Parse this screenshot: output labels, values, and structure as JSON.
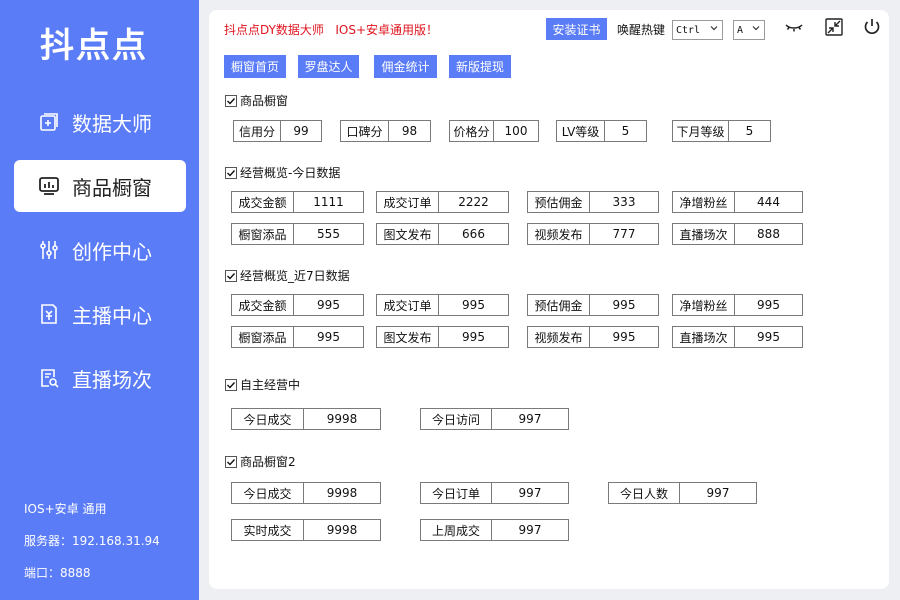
{
  "sidebar": {
    "logo": "抖点点",
    "items": [
      {
        "label": "数据大师",
        "icon": "data-add-icon"
      },
      {
        "label": "商品橱窗",
        "icon": "display-icon"
      },
      {
        "label": "创作中心",
        "icon": "sliders-icon"
      },
      {
        "label": "主播中心",
        "icon": "anchor-doc-icon"
      },
      {
        "label": "直播场次",
        "icon": "search-doc-icon"
      }
    ],
    "active_index": 1,
    "info": {
      "platform": "IOS+安卓 通用",
      "server": "服务器：192.168.31.94",
      "port": "端口：8888"
    }
  },
  "header": {
    "title": "抖点点DY数据大师   IOS+安卓通用版！",
    "cert_button": "安装证书",
    "hotkey_label": "唤醒热键",
    "hotkey_mod": "Ctrl",
    "hotkey_key": "A"
  },
  "tabs": [
    "橱窗首页",
    "罗盘达人",
    "佣金统计",
    "新版提现"
  ],
  "sections": {
    "s1": {
      "label": "商品橱窗",
      "fields": [
        {
          "label": "信用分",
          "value": "99"
        },
        {
          "label": "口碑分",
          "value": "98"
        },
        {
          "label": "价格分",
          "value": "100"
        },
        {
          "label": "LV等级",
          "value": "5"
        },
        {
          "label": "下月等级",
          "value": "5"
        }
      ]
    },
    "s2": {
      "label": "经营概览-今日数据",
      "fields": [
        {
          "label": "成交金额",
          "value": "1111"
        },
        {
          "label": "成交订单",
          "value": "2222"
        },
        {
          "label": "预估佣金",
          "value": "333"
        },
        {
          "label": "净增粉丝",
          "value": "444"
        },
        {
          "label": "橱窗添品",
          "value": "555"
        },
        {
          "label": "图文发布",
          "value": "666"
        },
        {
          "label": "视频发布",
          "value": "777"
        },
        {
          "label": "直播场次",
          "value": "888"
        }
      ]
    },
    "s3": {
      "label": "经营概览_近7日数据",
      "fields": [
        {
          "label": "成交金额",
          "value": "995"
        },
        {
          "label": "成交订单",
          "value": "995"
        },
        {
          "label": "预估佣金",
          "value": "995"
        },
        {
          "label": "净增粉丝",
          "value": "995"
        },
        {
          "label": "橱窗添品",
          "value": "995"
        },
        {
          "label": "图文发布",
          "value": "995"
        },
        {
          "label": "视频发布",
          "value": "995"
        },
        {
          "label": "直播场次",
          "value": "995"
        }
      ]
    },
    "s4": {
      "label": "自主经营中",
      "fields": [
        {
          "label": "今日成交",
          "value": "9998"
        },
        {
          "label": "今日访问",
          "value": "997"
        }
      ]
    },
    "s5": {
      "label": "商品橱窗2",
      "fields": [
        {
          "label": "今日成交",
          "value": "9998"
        },
        {
          "label": "今日订单",
          "value": "997"
        },
        {
          "label": "今日人数",
          "value": "997"
        },
        {
          "label": "实时成交",
          "value": "9998"
        },
        {
          "label": "上周成交",
          "value": "997"
        }
      ]
    }
  },
  "colors": {
    "accent": "#5b7cf7",
    "title_red": "#e0141e",
    "background": "#eeeff3"
  }
}
